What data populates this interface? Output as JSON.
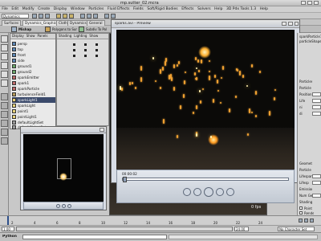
{
  "window": {
    "title": "mp.sutter_02.mcra"
  },
  "menu": [
    "File",
    "Edit",
    "Modify",
    "Create",
    "Display",
    "Window",
    "Particles",
    "Fluid Effects",
    "Fields",
    "Soft/Rigid Bodies",
    "Effects",
    "Solvers",
    "Help",
    "3D Pdx Tools 1.3",
    "Help"
  ],
  "status": {
    "mode": "Dynamics"
  },
  "shelf_tabs": [
    "Surfaces",
    "Dynamics_Graphics",
    "Cloth",
    "Dynamics",
    "General",
    "Polygons",
    "Rendering",
    "Deformation",
    "Animation",
    "Cloth"
  ],
  "outliner_menus": [
    "Display",
    "Show",
    "Panels"
  ],
  "outliner": [
    "persp",
    "top",
    "front",
    "side",
    "ground1",
    "ground2",
    "sparkEmitter",
    "spark1",
    "sparkParticle",
    "turbulenceField1",
    "sparkLight1",
    "sparkLight",
    "point1",
    "pointLight1",
    "defaultLightSet",
    "defaultObjectSet"
  ],
  "outliner_selected": 10,
  "panel_menus": [
    "Shading",
    "Lighting",
    "Show",
    "Panels"
  ],
  "panel_shelf": [
    "Mishap",
    "Polygons to Sur",
    "Subdiv To Pol",
    "Subdiv Polygo",
    "Emitter",
    "Hide",
    "Motion_Trail"
  ],
  "viewport": {
    "fps_label": "0 fps"
  },
  "player": {
    "title": "sparks.avi - Preview",
    "time": "00:00:02",
    "buttons": [
      "rewind",
      "step-back",
      "play",
      "step-forward",
      "fast-forward"
    ]
  },
  "attributes": {
    "header": [
      "sparkParticle1",
      "particleShape"
    ],
    "rows": [
      "Particles",
      "Particle Ren",
      "Position",
      "Life",
      "ni",
      "di",
      "Geometry",
      "Particle",
      "Lifespan",
      "Lifesp",
      "Emission",
      "Num Gen",
      "Shading"
    ],
    "checks": [
      "Point",
      "Render"
    ],
    "footer": [
      "Notes",
      "Select",
      "Load Attr",
      "Copy Tab",
      "Close"
    ]
  },
  "timeline": {
    "start": "1",
    "end": "24",
    "marks": [
      "2",
      "4",
      "6",
      "8",
      "10",
      "12",
      "14",
      "16",
      "18",
      "20",
      "22",
      "24"
    ]
  },
  "range": {
    "start": "1.00",
    "end": "24.00",
    "char_set": "No Character Set"
  },
  "cmd": {
    "label": "Python"
  },
  "colors": {
    "viewport_bg": "#111111",
    "spark": "#f0a030",
    "ui_bg": "#c8c8c8",
    "selection": "#3b4a6b"
  }
}
